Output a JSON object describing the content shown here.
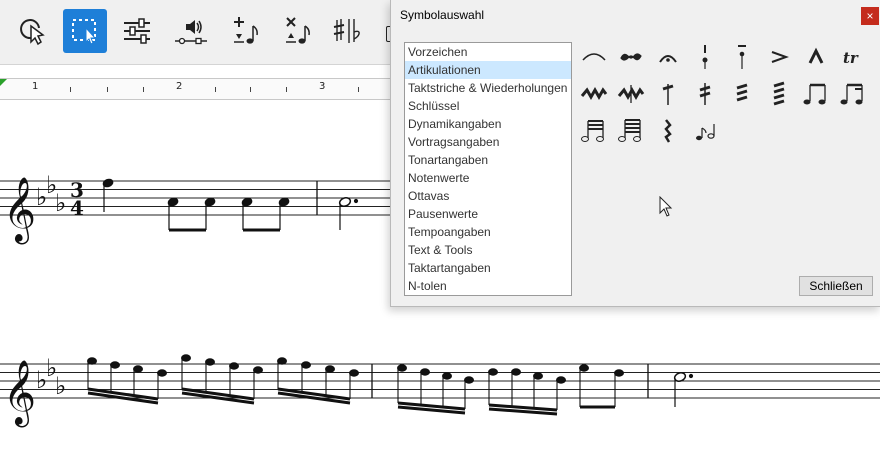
{
  "toolbar": {
    "tools": [
      {
        "name": "pointer-tool",
        "icon": "pointer-arrow-icon",
        "active": false
      },
      {
        "name": "select-tool",
        "icon": "select-rectangle-icon",
        "active": true
      },
      {
        "name": "mixer-tool",
        "icon": "sliders-icon",
        "active": false
      },
      {
        "name": "playback-tool",
        "icon": "sound-icon",
        "active": false
      },
      {
        "name": "add-note-tool",
        "icon": "add-note-icon",
        "active": false
      },
      {
        "name": "delete-note-tool",
        "icon": "delete-note-icon",
        "active": false
      },
      {
        "name": "accidental-tool",
        "icon": "accidental-icon",
        "active": false
      }
    ],
    "accent": "#1e7fd8"
  },
  "ruler": {
    "marks": [
      "1",
      "2",
      "3"
    ]
  },
  "score": {
    "time_signature_top": "3",
    "time_signature_bottom": "4"
  },
  "dialog": {
    "title": "Symbolauswahl",
    "close_glyph": "×",
    "categories": [
      "Vorzeichen",
      "Artikulationen",
      "Taktstriche & Wiederholungen",
      "Schlüssel",
      "Dynamikangaben",
      "Vortragsangaben",
      "Tonartangaben",
      "Notenwerte",
      "Ottavas",
      "Pausenwerte",
      "Tempoangaben",
      "Text & Tools",
      "Taktartangaben",
      "N-tolen"
    ],
    "selected_category": "Artikulationen",
    "symbols": [
      "slur-icon",
      "turn-icon",
      "fermata-icon",
      "staccato-tenuto-icon",
      "tenuto-staccato-icon",
      "accent-icon",
      "marcato-icon",
      "trill-icon",
      "mordent-icon",
      "double-mordent-icon",
      "tremolo-single-icon",
      "tremolo-double-icon",
      "tremolo-triple-icon",
      "tremolo-quad-icon",
      "beamed-eighths-icon",
      "beamed-sixteenth-icon",
      "beamed-tremolo-icon",
      "beamed-tremolo-double-icon",
      "rest-squiggle-icon",
      "grace-note-icon"
    ],
    "trill_text": "tr",
    "close_button_label": "Schließen"
  }
}
